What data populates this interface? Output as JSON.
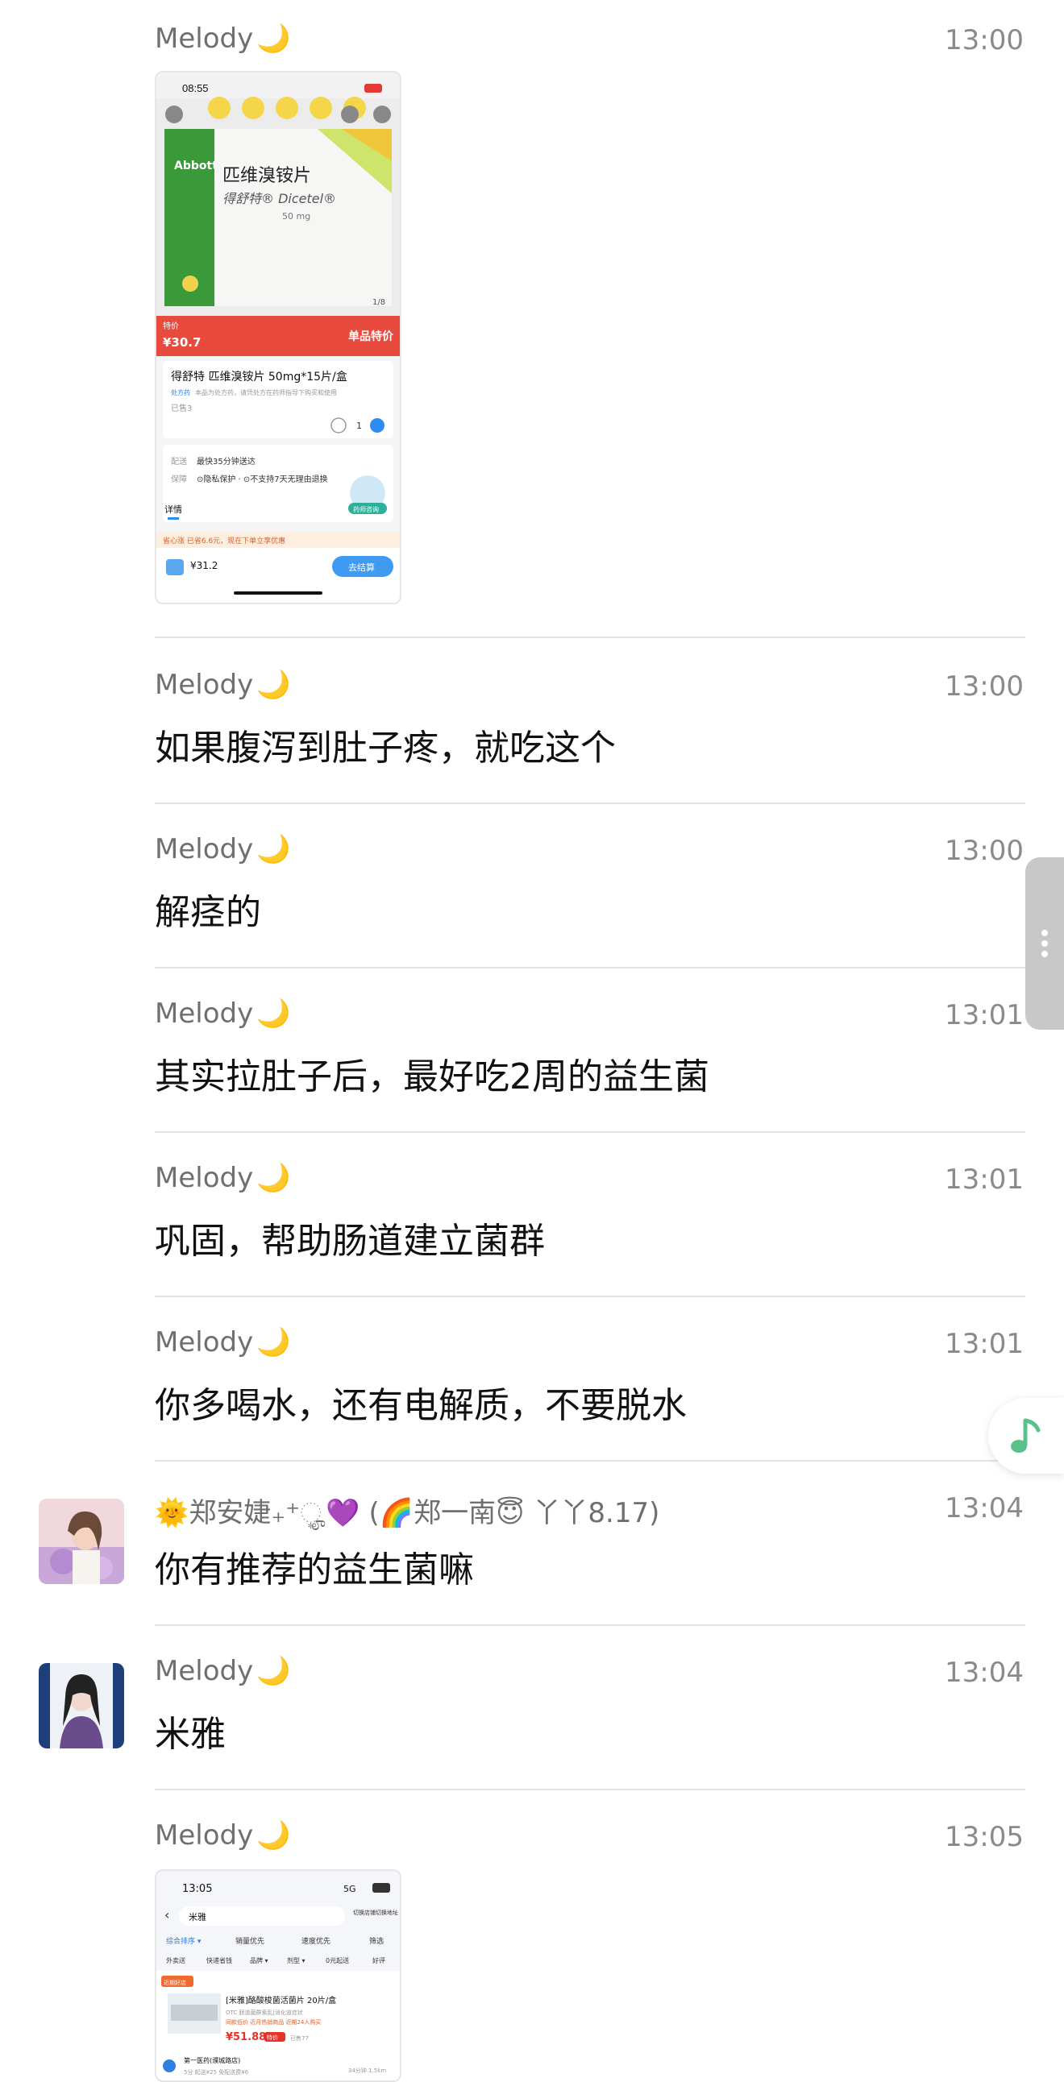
{
  "messages": [
    {
      "sender": "Melody",
      "sender_emoji": "🌙",
      "time": "13:00",
      "type": "image",
      "image_desc": "shop-screenshot-1"
    },
    {
      "sender": "Melody",
      "sender_emoji": "🌙",
      "time": "13:00",
      "type": "text",
      "text": "如果腹泻到肚子疼，就吃这个"
    },
    {
      "sender": "Melody",
      "sender_emoji": "🌙",
      "time": "13:00",
      "type": "text",
      "text": "解痉的"
    },
    {
      "sender": "Melody",
      "sender_emoji": "🌙",
      "time": "13:01",
      "type": "text",
      "text": "其实拉肚子后，最好吃2周的益生菌"
    },
    {
      "sender": "Melody",
      "sender_emoji": "🌙",
      "time": "13:01",
      "type": "text",
      "text": "巩固，帮助肠道建立菌群"
    },
    {
      "sender": "Melody",
      "sender_emoji": "🌙",
      "time": "13:01",
      "type": "text",
      "text": "你多喝水，还有电解质，不要脱水"
    },
    {
      "sender": "🌞郑安婕₊⁺ೄ͙💜 (🌈郑一南😇 丫丫8.17)",
      "sender_emoji": "",
      "time": "13:04",
      "type": "text",
      "text": "你有推荐的益生菌嘛"
    },
    {
      "sender": "Melody",
      "sender_emoji": "🌙",
      "time": "13:04",
      "type": "text",
      "text": "米雅"
    },
    {
      "sender": "Melody",
      "sender_emoji": "🌙",
      "time": "13:05",
      "type": "image",
      "image_desc": "shop-screenshot-2"
    }
  ],
  "screenshot1": {
    "status_time": "08:55",
    "brand": "Abbott",
    "drug_cn": "匹维溴铵片",
    "drug_brand": "得舒特® Dicetel®",
    "dose": "50 mg",
    "page_index": "1/8",
    "price_label": "特价",
    "price": "¥30.7",
    "banner": "单品特价",
    "product_title": "得舒特 匹维溴铵片 50mg*15片/盒",
    "rx_tag": "处方药",
    "rx_note": "本品为处方药，请凭处方在药师指导下购买和使用",
    "sold": "已售3",
    "qty": "1",
    "delivery_label": "配送",
    "delivery": "最快35分钟送达",
    "guarantee_label": "保障",
    "guarantee": "⊙隐私保护 · ⊙不支持7天无理由退换",
    "pharmacist": "药师咨询",
    "details_tab": "详情",
    "promo": "省心涨  已省6.6元，现在下单立享优惠",
    "total": "¥31.2",
    "checkout": "去结算"
  },
  "screenshot2": {
    "status_time": "13:05",
    "signal": "5G",
    "search": "米雅",
    "cut1": "切换店铺",
    "cut2": "切换地址",
    "sort_tabs": [
      "综合排序 ▾",
      "销量优先",
      "速度优先",
      "筛选"
    ],
    "filter_chips": [
      "外卖送",
      "快递省钱",
      "品牌 ▾",
      "剂型 ▾",
      "0元起送",
      "好评"
    ],
    "badge": "近期好店",
    "product": "[米雅]酪酸梭菌活菌片 20片/盒",
    "product_sub": "OTC 肠道菌群紊乱|消化道症状",
    "tags": "同款低价 近月热销商品 近期24人购买",
    "price": "¥51.88",
    "price_tag": "特价",
    "sold": "已售77",
    "store": "第一医药(濮城路店)",
    "store_meta": "5分 起送¥25 免配送费¥6",
    "store_dist": "34分钟 1.5km"
  }
}
